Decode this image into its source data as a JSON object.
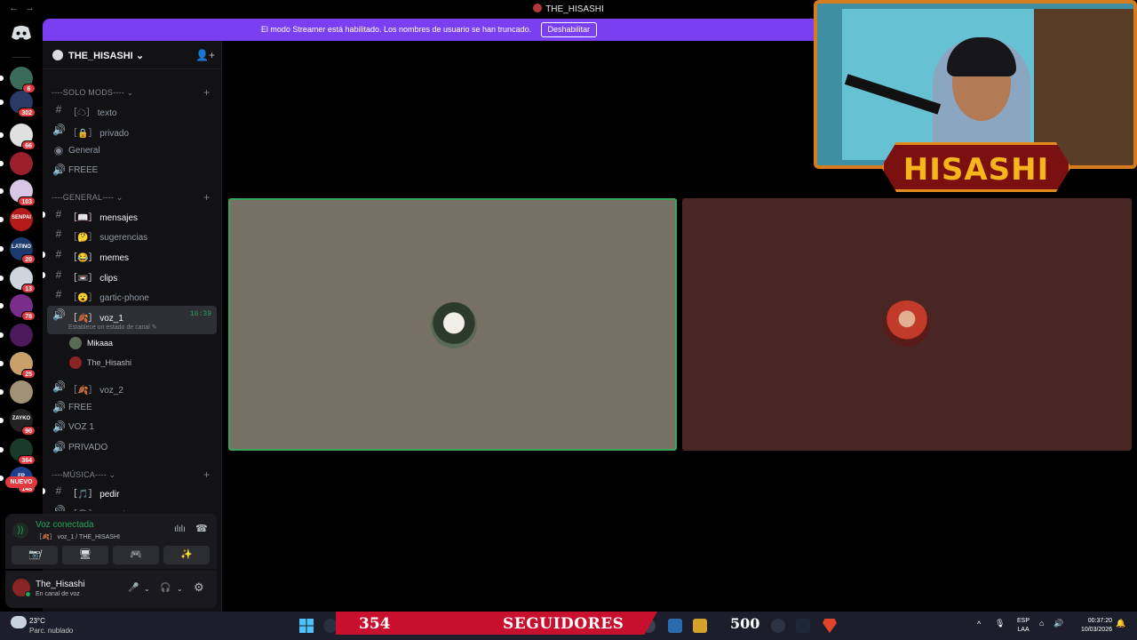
{
  "window": {
    "title": "THE_HISASHI",
    "back_icon": "←",
    "forward_icon": "→"
  },
  "banner": {
    "message": "El modo Streamer está habilitado. Los nombres de usuario se han truncado.",
    "button": "Deshabilitar",
    "color": "#7b3ff2"
  },
  "servers": [
    {
      "badge": "6",
      "color": "#3a6b5a"
    },
    {
      "badge": "302",
      "color": "#2b3b66"
    },
    {
      "badge": "66",
      "color": "#e0e0e0"
    },
    {
      "badge": "",
      "color": "#9b1f2a"
    },
    {
      "badge": "103",
      "color": "#d7c6e6"
    },
    {
      "badge": "",
      "color": "#b51a1a",
      "text": "SENPAI"
    },
    {
      "badge": "20",
      "color": "#1c3b6e",
      "text": "LATINO"
    },
    {
      "badge": "13",
      "color": "#cfd5dd"
    },
    {
      "badge": "78",
      "color": "#7a2e8c"
    },
    {
      "badge": "",
      "color": "#4a1a5c"
    },
    {
      "badge": "25",
      "color": "#c7a06a"
    },
    {
      "badge": "",
      "color": "#a09274"
    },
    {
      "badge": "90",
      "color": "#222",
      "text": "ZAYKO"
    },
    {
      "badge": "364",
      "color": "#1a3a2a"
    },
    {
      "badge": "148",
      "color": "#1b3d8c",
      "text": "FP"
    }
  ],
  "rail_new_badge": "NUEVO",
  "guild": {
    "name": "THE_HISASHI",
    "chevron": "⌄",
    "invite_icon": "👤+"
  },
  "categories": {
    "mods": "----SOLO MODS----",
    "general": "----GENERAL----",
    "musica": "----MÚSICA----",
    "plus": "+",
    "chevron": "⌄"
  },
  "channels": {
    "texto": {
      "prefix": "［",
      "emoji": "☁",
      "suffix": "］",
      "name": "texto"
    },
    "privado": {
      "prefix": "［",
      "emoji": "🔒",
      "suffix": "］",
      "name": "privado"
    },
    "general_stage": {
      "name": "General"
    },
    "freee": {
      "name": "FREEE"
    },
    "mensajes": {
      "prefix": "［",
      "emoji": "📖",
      "suffix": "］",
      "name": "mensajes"
    },
    "sugerencias": {
      "prefix": "［",
      "emoji": "🤔",
      "suffix": "］",
      "name": "sugerencias"
    },
    "memes": {
      "prefix": "［",
      "emoji": "😂",
      "suffix": "］",
      "name": "memes"
    },
    "clips": {
      "prefix": "［",
      "emoji": "📼",
      "suffix": "］",
      "name": "clips"
    },
    "gartic": {
      "prefix": "［",
      "emoji": "😮",
      "suffix": "］",
      "name": "gartic-phone"
    },
    "voz1": {
      "prefix": "［",
      "emoji": "🍂",
      "suffix": "］",
      "name": "voz_1",
      "time": "16:39",
      "status": "Establece un estado de canal ✎"
    },
    "voz2": {
      "prefix": "［",
      "emoji": "🍂",
      "suffix": "］",
      "name": "voz_2"
    },
    "free": {
      "name": "FREE"
    },
    "voz1b": {
      "name": "VOZ 1"
    },
    "privado2": {
      "name": "PRIVADO"
    },
    "pedir": {
      "prefix": "［",
      "emoji": "🎵",
      "suffix": "］",
      "name": "pedir"
    },
    "escuchar": {
      "prefix": "［",
      "emoji": "🎧",
      "suffix": "］",
      "name": "escuchar"
    }
  },
  "icons": {
    "hash": "#",
    "speaker": "🔊",
    "stage": "◉"
  },
  "voice_members": [
    {
      "name": "Mikaaa",
      "color": "#f2f3f5",
      "avatar": "#5a6b55"
    },
    {
      "name": "The_Hisashi",
      "color": "#b5bac1",
      "avatar": "#8a2424"
    }
  ],
  "voice_panel": {
    "title": "Voz conectada",
    "location": "［🍂］ voz_1 / THE_HISASHI",
    "signal_icon": "))",
    "wave_icon": "ılılı",
    "hangup_icon": "☎",
    "buttons": [
      "📷̸",
      "🖥",
      "🎮",
      "✨"
    ]
  },
  "user_panel": {
    "name": "The_Hisashi",
    "status": "En canal de voz",
    "mic_icon": "🎤",
    "headset_icon": "🎧",
    "gear_icon": "⚙",
    "chevron": "⌄"
  },
  "tiles": {
    "left_color": "#777064",
    "left_border": "#3ba55c",
    "right_color": "#472624"
  },
  "webcam": {
    "nameplate": "HISASHI"
  },
  "taskbar": {
    "temperature": "23°C",
    "weather": "Parc. nublado",
    "followers_count": "354",
    "followers_label": "SEGUIDORES",
    "goal": "500",
    "lang_top": "ESP",
    "lang_bottom": "LAA",
    "time": "00:37:20",
    "date": "10/03/2026",
    "chevron_up": "^",
    "mic_icon": "🎙",
    "wifi_icon": "⌂",
    "volume_icon": "🔊",
    "bell_icon": "🔔"
  }
}
